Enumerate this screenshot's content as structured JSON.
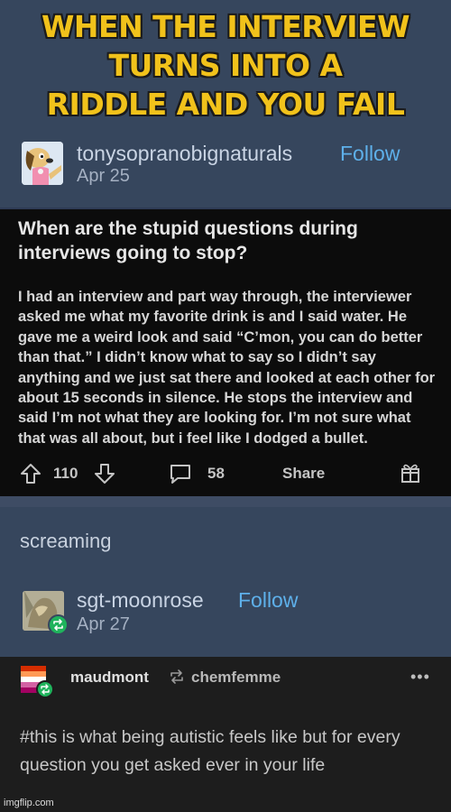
{
  "meme": {
    "caption_lines": [
      "WHEN THE INTERVIEW",
      "TURNS INTO A",
      "RIDDLE AND YOU FAIL"
    ]
  },
  "post": {
    "username": "tonysopranobignaturals",
    "follow_label": "Follow",
    "date": "Apr 25",
    "title": "When are the stupid questions during interviews going to stop?",
    "body": "I had an interview and part way through, the interviewer asked me what my favorite drink is and I said water. He gave me a weird look and said “C’mon, you can do better than that.” I didn’t know what to say so I didn’t say anything and we just sat there and looked at each other for about 15 seconds in silence. He stops the interview and said I’m not what they are looking for. I’m not sure what that was all about, but i feel like I dodged a bullet.",
    "upvotes": "110",
    "comments": "58",
    "share_label": "Share"
  },
  "reply": {
    "text": "screaming",
    "username": "sgt-moonrose",
    "follow_label": "Follow",
    "date": "Apr 27"
  },
  "reblog": {
    "username": "maudmont",
    "reblogged_from": "chemfemme",
    "tags": "#this is what being autistic feels like but for every question you get asked ever in your life"
  },
  "watermark": "imgflip.com",
  "colors": {
    "caption": "#f1c21b",
    "tumblr_bg": "#36465d",
    "follow": "#5eb0ea",
    "reblog_badge": "#1fb35c"
  }
}
